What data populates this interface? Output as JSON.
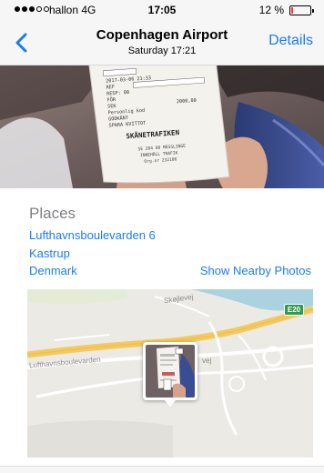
{
  "status_bar": {
    "carrier": "hallon",
    "network": "4G",
    "time": "17:05",
    "battery_percent": "12 %",
    "battery_level": 0.12,
    "battery_color": "#ff3b30"
  },
  "nav": {
    "back_icon": "chevron-left-icon",
    "title": "Copenhagen Airport",
    "subtitle": "Saturday  17:21",
    "details_label": "Details"
  },
  "receipt": {
    "line_date": "2017-03-06 21:33",
    "line_ref": "REF",
    "line_resp": "RESP: 00",
    "line_for": "FÖR",
    "line_sek": "SEK",
    "line_sek_amount": "2000,00",
    "line_personlig": "Personlig kod",
    "line_godkant": "GODKÄNT",
    "line_spara": "SPARA KVITTOT",
    "line_skane": "SKÅNETRAFIKEN",
    "line_footer1": "SE 204 08 MÄSSLINGE",
    "line_footer2": "INNEHÅLL TRAFIK",
    "line_footer3": "Org.nr 232100"
  },
  "places": {
    "title": "Places",
    "street": "Lufthavnsboulevarden 6",
    "city": "Kastrup",
    "country": "Denmark",
    "nearby_label": "Show Nearby Photos"
  },
  "map": {
    "label_skjellevej": "Skøjlevej",
    "label_boulevard": "Lufthavnsboulevarden",
    "label_vej": "vej",
    "road_badge": "E20"
  },
  "colors": {
    "accent": "#1a7cf5",
    "motorway": "#f4c95d",
    "water": "#aad3df",
    "bar_bg": "#f6f6f7"
  }
}
